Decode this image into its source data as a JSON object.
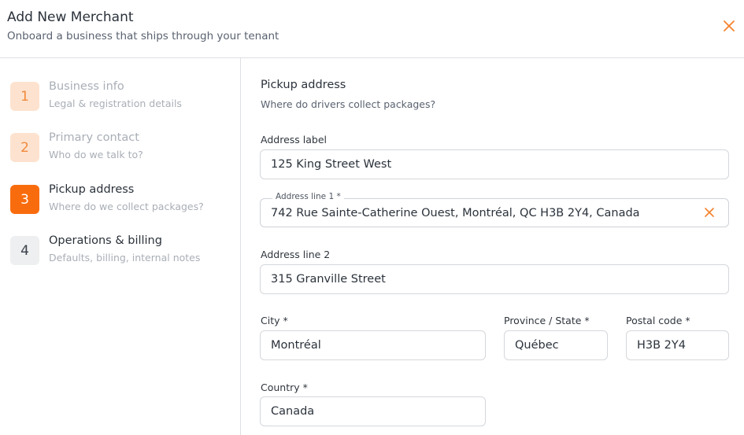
{
  "header": {
    "title": "Add New Merchant",
    "subtitle": "Onboard a business that ships through your tenant",
    "close_icon": "close-icon",
    "accent_color": "#f96c0e"
  },
  "steps": [
    {
      "number": "1",
      "title": "Business info",
      "description": "Legal & registration details",
      "state": "completed"
    },
    {
      "number": "2",
      "title": "Primary contact",
      "description": "Who do we talk to?",
      "state": "completed"
    },
    {
      "number": "3",
      "title": "Pickup address",
      "description": "Where do we collect packages?",
      "state": "active"
    },
    {
      "number": "4",
      "title": "Operations & billing",
      "description": "Defaults, billing, internal notes",
      "state": "upcoming"
    }
  ],
  "section": {
    "title": "Pickup address",
    "subtitle": "Where do drivers collect packages?"
  },
  "form": {
    "address_label": {
      "label": "Address label",
      "value": "125 King Street West"
    },
    "address_line1": {
      "label": "Address line 1 *",
      "value": "742 Rue Sainte-Catherine Ouest, Montréal, QC H3B 2Y4, Canada",
      "clear_icon": "clear-icon"
    },
    "address_line2": {
      "label": "Address line 2",
      "value": "315 Granville Street"
    },
    "city": {
      "label": "City *",
      "value": "Montréal"
    },
    "province": {
      "label": "Province / State *",
      "value": "Québec"
    },
    "postal_code": {
      "label": "Postal code *",
      "value": "H3B 2Y4"
    },
    "country": {
      "label": "Country *",
      "value": "Canada"
    }
  }
}
